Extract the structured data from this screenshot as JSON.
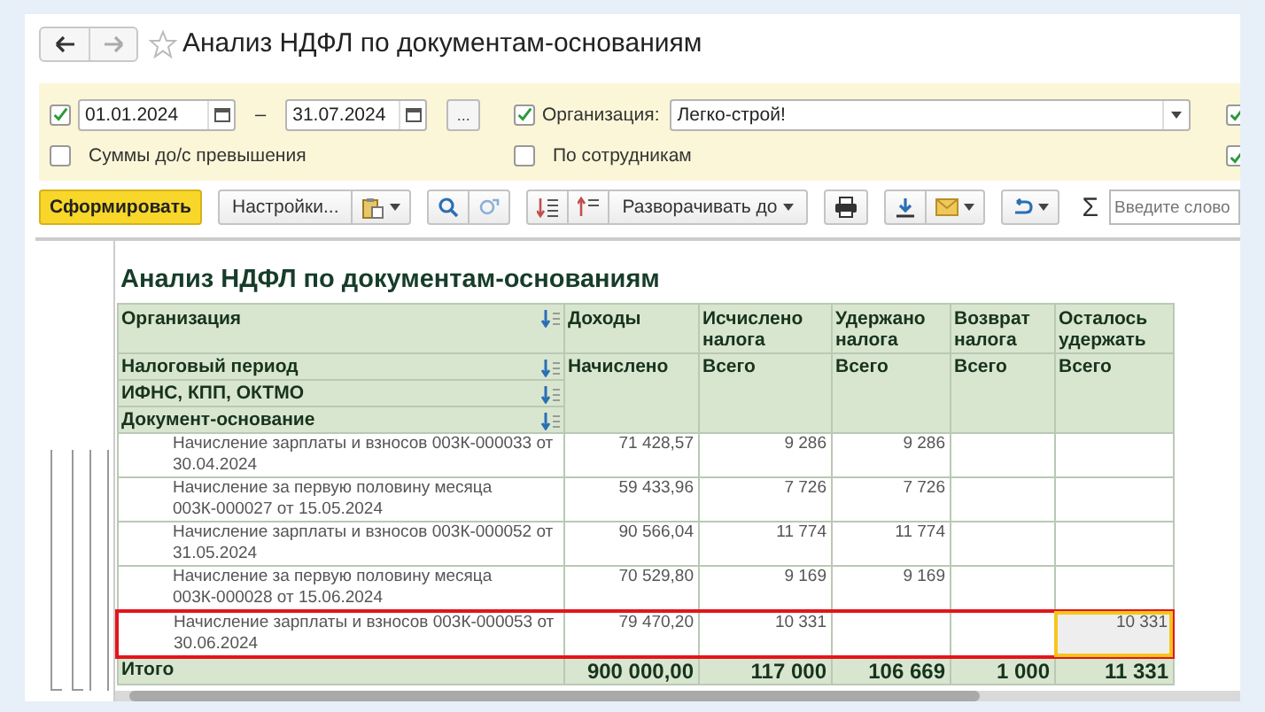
{
  "window": {
    "title": "Анализ НДФЛ по документам-основаниям"
  },
  "filters": {
    "period": {
      "checked": true,
      "from": "01.01.2024",
      "separator": "–",
      "to": "31.07.2024",
      "more_button": "..."
    },
    "organization": {
      "checked": true,
      "label": "Организация:",
      "value": "Легко-строй!"
    },
    "options": [
      {
        "label": "Суммы до/с превышения",
        "checked": false
      },
      {
        "label": "По сотрудникам",
        "checked": false
      }
    ],
    "edge_checkboxes": [
      {
        "checked": true
      },
      {
        "checked": true
      }
    ]
  },
  "toolbar": {
    "generate_button": "Сформировать",
    "settings_button": "Настройки...",
    "expand_button": "Разворачивать до",
    "sum_symbol": "Σ",
    "search": {
      "placeholder": "Введите слово"
    }
  },
  "report": {
    "title": "Анализ НДФЛ по документам-основаниям",
    "groupings": [
      "Организация",
      "Налоговый период",
      "ИФНС, КПП, ОКТМО",
      "Документ-основание"
    ],
    "columns": [
      {
        "title": "Доходы",
        "subtitle": "Начислено"
      },
      {
        "title": "Исчислено налога",
        "subtitle": "Всего"
      },
      {
        "title": "Удержано налога",
        "subtitle": "Всего"
      },
      {
        "title": "Возврат налога",
        "subtitle": "Всего"
      },
      {
        "title": "Осталось удержать",
        "subtitle": "Всего"
      }
    ],
    "rows": [
      {
        "document": "Начисление зарплаты и взносов 003К-000033 от 30.04.2024",
        "highlighted": false,
        "values": [
          {
            "text": "71 428,57",
            "selected": false
          },
          {
            "text": "9 286",
            "selected": false
          },
          {
            "text": "9 286",
            "selected": false
          },
          {
            "selected": false
          },
          {
            "selected": false
          }
        ]
      },
      {
        "document": "Начисление за первую половину месяца 003К-000027 от 15.05.2024",
        "highlighted": false,
        "values": [
          {
            "text": "59 433,96",
            "selected": false
          },
          {
            "text": "7 726",
            "selected": false
          },
          {
            "text": "7 726",
            "selected": false
          },
          {
            "selected": false
          },
          {
            "selected": false
          }
        ]
      },
      {
        "document": "Начисление зарплаты и взносов 003К-000052 от 31.05.2024",
        "highlighted": false,
        "values": [
          {
            "text": "90 566,04",
            "selected": false
          },
          {
            "text": "11 774",
            "selected": false
          },
          {
            "text": "11 774",
            "selected": false
          },
          {
            "selected": false
          },
          {
            "selected": false
          }
        ]
      },
      {
        "document": "Начисление за первую половину месяца 003К-000028 от 15.06.2024",
        "highlighted": false,
        "values": [
          {
            "text": "70 529,80",
            "selected": false
          },
          {
            "text": "9 169",
            "selected": false
          },
          {
            "text": "9 169",
            "selected": false
          },
          {
            "selected": false
          },
          {
            "selected": false
          }
        ]
      },
      {
        "document": "Начисление зарплаты и взносов 003К-000053 от 30.06.2024",
        "highlighted": true,
        "values": [
          {
            "text": "79 470,20",
            "selected": false
          },
          {
            "text": "10 331",
            "selected": false
          },
          {
            "selected": false
          },
          {
            "selected": false
          },
          {
            "text": "10 331",
            "selected": true
          }
        ]
      }
    ],
    "total": {
      "label": "Итого",
      "values": [
        "900 000,00",
        "117 000",
        "106 669",
        "1 000",
        "11 331"
      ]
    }
  }
}
